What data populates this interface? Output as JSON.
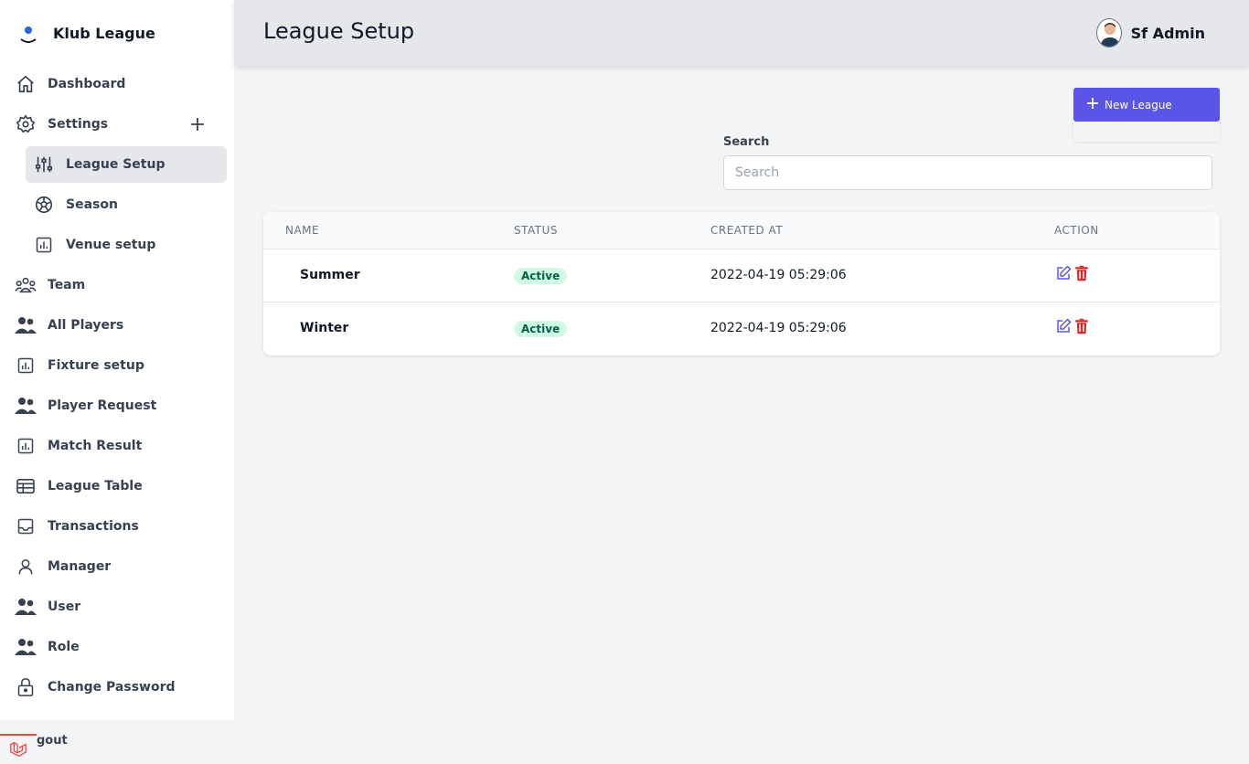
{
  "brand": {
    "name": "Klub League"
  },
  "sidebar": {
    "items": [
      {
        "label": "Dashboard",
        "icon": "home-icon"
      },
      {
        "label": "Settings",
        "icon": "gear-icon"
      },
      {
        "label": "League Setup",
        "icon": "sliders-icon"
      },
      {
        "label": "Season",
        "icon": "soccer-ball-icon"
      },
      {
        "label": "Venue setup",
        "icon": "chart-icon"
      },
      {
        "label": "Team",
        "icon": "team-icon"
      },
      {
        "label": "All Players",
        "icon": "users-icon"
      },
      {
        "label": "Fixture setup",
        "icon": "chart-icon"
      },
      {
        "label": "Player Request",
        "icon": "users-icon"
      },
      {
        "label": "Match Result",
        "icon": "chart-icon"
      },
      {
        "label": "League Table",
        "icon": "table-icon"
      },
      {
        "label": "Transactions",
        "icon": "inbox-icon"
      },
      {
        "label": "Manager",
        "icon": "user-icon"
      },
      {
        "label": "User",
        "icon": "users-icon"
      },
      {
        "label": "Role",
        "icon": "users-icon"
      },
      {
        "label": "Change Password",
        "icon": "lock-icon"
      }
    ],
    "logout_label": "gout"
  },
  "header": {
    "title": "League Setup",
    "user_name": "Sf Admin"
  },
  "toolbar": {
    "new_label": "New League"
  },
  "search": {
    "label": "Search",
    "placeholder": "Search"
  },
  "table": {
    "columns": [
      "NAME",
      "STATUS",
      "CREATED AT",
      "ACTION"
    ],
    "rows": [
      {
        "name": "Summer",
        "status": "Active",
        "created_at": "2022-04-19 05:29:06"
      },
      {
        "name": "Winter",
        "status": "Active",
        "created_at": "2022-04-19 05:29:06"
      }
    ]
  },
  "colors": {
    "accent": "#5a55e6",
    "edit": "#5a55e6",
    "delete": "#dc2626",
    "status_bg": "#d1fae5",
    "status_text": "#065f46"
  }
}
